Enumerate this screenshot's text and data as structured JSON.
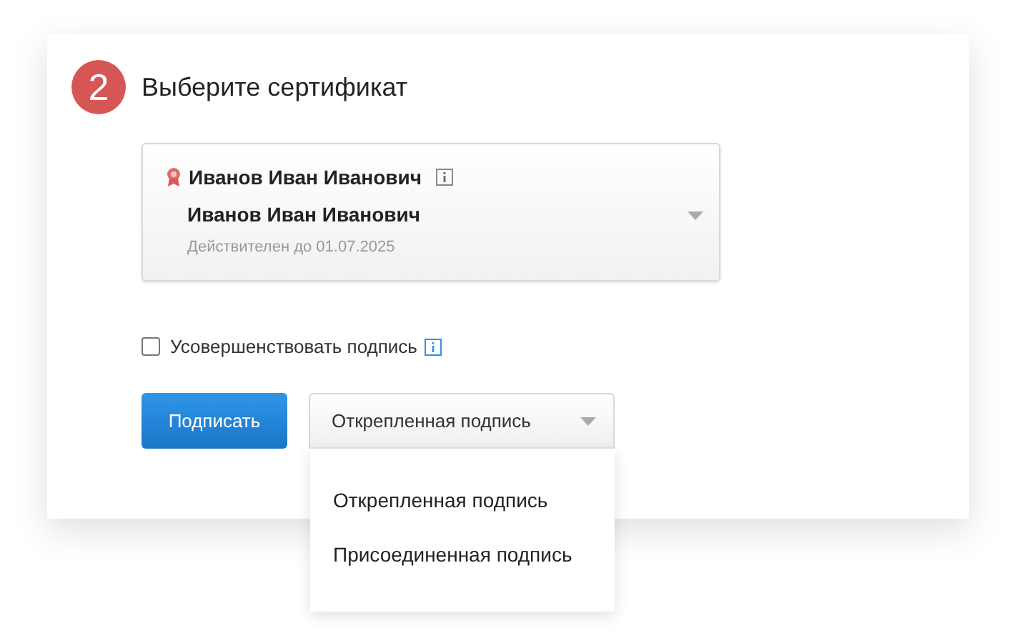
{
  "step": {
    "number": "2",
    "title": "Выберите сертификат"
  },
  "certificate": {
    "owner": "Иванов Иван Иванович",
    "name": "Иванов Иван Иванович",
    "valid_until": "Действителен до 01.07.2025"
  },
  "enhance": {
    "label": "Усовершенствовать подпись",
    "checked": false
  },
  "sign_button": "Подписать",
  "signature_type": {
    "value": "Открепленная подпись",
    "expanded": true,
    "options": [
      {
        "label": "Открепленная подпись"
      },
      {
        "label": "Присоединенная подпись"
      }
    ]
  }
}
